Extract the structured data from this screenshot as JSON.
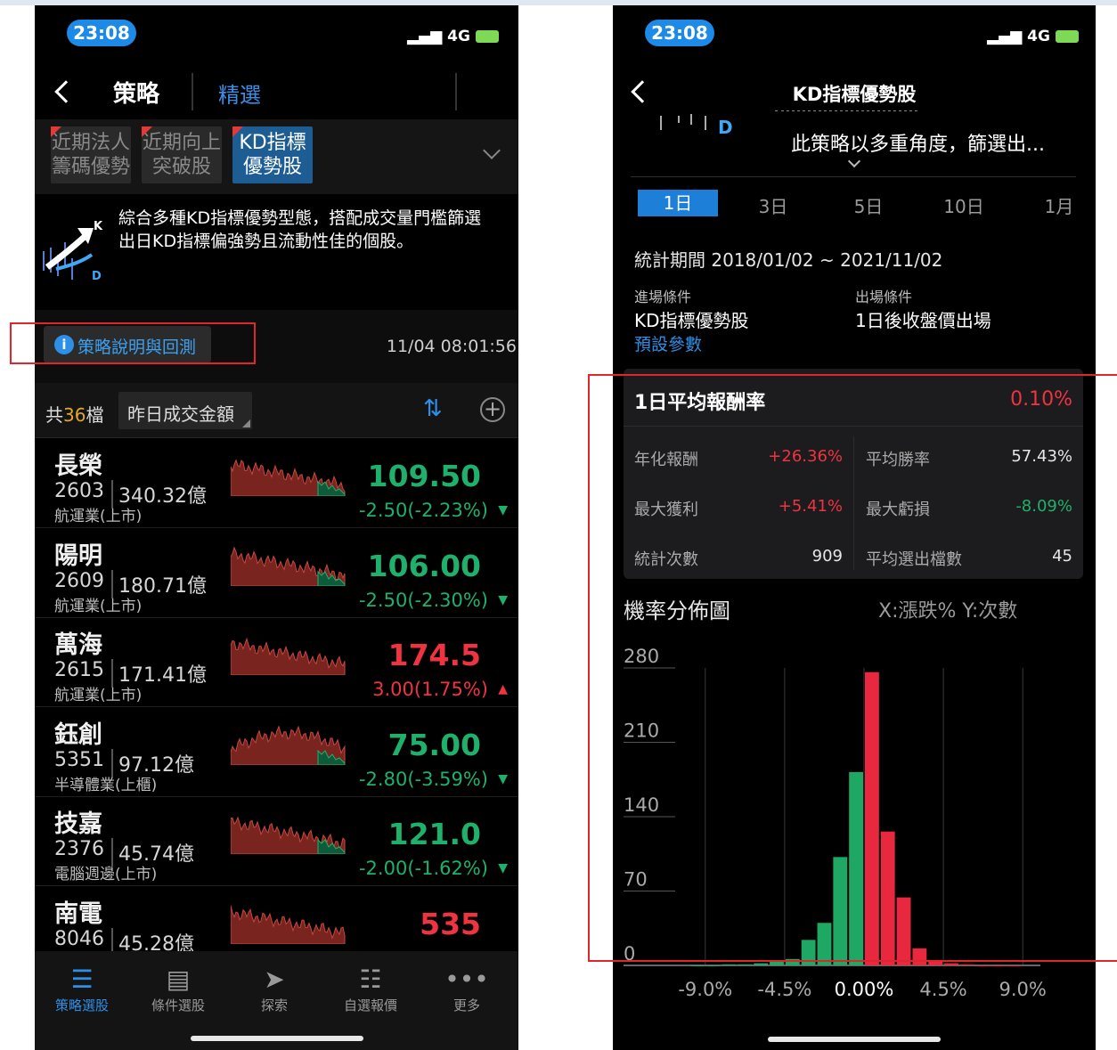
{
  "status_time": "23:08",
  "network": "4G",
  "left": {
    "header": {
      "title": "策略",
      "tab": "精選"
    },
    "strategies": [
      {
        "line1": "近期法人",
        "line2": "籌碼優勢"
      },
      {
        "line1": "近期向上",
        "line2": "突破股"
      },
      {
        "line1": "KD指標",
        "line2": "優勢股"
      }
    ],
    "logo_k": "K",
    "logo_d": "D",
    "description": "綜合多種KD指標優勢型態，搭配成交量門檻篩選出日KD指標偏強勢且流動性佳的個股。",
    "explain_button": "策略說明與回測",
    "timestamp": "11/04 08:01:56",
    "count_prefix": "共",
    "count": "36",
    "count_suffix": "檔",
    "sort_label": "昨日成交金額",
    "stocks": [
      {
        "name": "長榮",
        "code": "2603",
        "cap": "340.32億",
        "industry": "航運業(上市)",
        "price": "109.50",
        "change": "-2.50(-2.23%)",
        "dir": "down"
      },
      {
        "name": "陽明",
        "code": "2609",
        "cap": "180.71億",
        "industry": "航運業(上市)",
        "price": "106.00",
        "change": "-2.50(-2.30%)",
        "dir": "down"
      },
      {
        "name": "萬海",
        "code": "2615",
        "cap": "171.41億",
        "industry": "航運業(上市)",
        "price": "174.5",
        "change": "3.00(1.75%)",
        "dir": "up"
      },
      {
        "name": "鈺創",
        "code": "5351",
        "cap": "97.12億",
        "industry": "半導體業(上櫃)",
        "price": "75.00",
        "change": "-2.80(-3.59%)",
        "dir": "down"
      },
      {
        "name": "技嘉",
        "code": "2376",
        "cap": "45.74億",
        "industry": "電腦週邊(上市)",
        "price": "121.0",
        "change": "-2.00(-1.62%)",
        "dir": "down"
      },
      {
        "name": "南電",
        "code": "8046",
        "cap": "45.28億",
        "industry": "",
        "price": "535",
        "change": "",
        "dir": "up"
      }
    ],
    "nav": [
      {
        "label": "策略選股",
        "icon": "strategy-icon",
        "active": true
      },
      {
        "label": "條件選股",
        "icon": "condition-icon",
        "active": false
      },
      {
        "label": "探索",
        "icon": "explore-icon",
        "active": false
      },
      {
        "label": "自選報價",
        "icon": "watchlist-icon",
        "active": false
      },
      {
        "label": "更多",
        "icon": "more-icon",
        "active": false
      }
    ]
  },
  "right": {
    "title": "KD指標優勢股",
    "desc_snippet": "此策略以多重角度，篩選出...",
    "logo_d": "D",
    "periods": [
      "1日",
      "3日",
      "5日",
      "10日",
      "1月"
    ],
    "period_stat": "統計期間 2018/01/02 ~ 2021/11/02",
    "entry_label": "進場條件",
    "entry_value": "KD指標優勢股",
    "exit_label": "出場條件",
    "exit_value": "1日後收盤價出場",
    "default_params": "預設參數",
    "avg_return_label": "1日平均報酬率",
    "avg_return_value": "0.10%",
    "stats": [
      {
        "label": "年化報酬",
        "value": "+26.36%",
        "color": "red"
      },
      {
        "label": "平均勝率",
        "value": "57.43%",
        "color": "white"
      },
      {
        "label": "最大獲利",
        "value": "+5.41%",
        "color": "red"
      },
      {
        "label": "最大虧損",
        "value": "-8.09%",
        "color": "green"
      },
      {
        "label": "統計次數",
        "value": "909",
        "color": "white"
      },
      {
        "label": "平均選出檔數",
        "value": "45",
        "color": "white"
      }
    ],
    "dist_title": "機率分佈圖",
    "dist_axes": "X:漲跌%  Y:次數"
  },
  "chart_data": {
    "type": "bar",
    "title": "機率分佈圖",
    "xlabel": "X:漲跌%",
    "ylabel": "Y:次數",
    "yticks": [
      "280",
      "210",
      "140",
      "70",
      "0"
    ],
    "ylim": [
      0,
      280
    ],
    "xticks": [
      "-9.0%",
      "-4.5%",
      "0.00%",
      "4.5%",
      "9.0%"
    ],
    "xlim": [
      -10,
      10
    ],
    "bin_width": 0.9,
    "x": [
      -9.45,
      -8.55,
      -7.65,
      -6.75,
      -5.85,
      -4.95,
      -4.05,
      -3.15,
      -2.25,
      -1.35,
      -0.45,
      0.45,
      1.35,
      2.25,
      3.15,
      4.05,
      4.95,
      5.85,
      6.75,
      7.65,
      8.55
    ],
    "values": [
      0,
      0,
      1,
      1,
      2,
      4,
      6,
      24,
      40,
      102,
      182,
      276,
      126,
      64,
      16,
      4,
      2,
      1,
      0,
      0,
      0
    ],
    "colors": {
      "negative": "#1fa764",
      "positive": "#e8283f"
    }
  }
}
